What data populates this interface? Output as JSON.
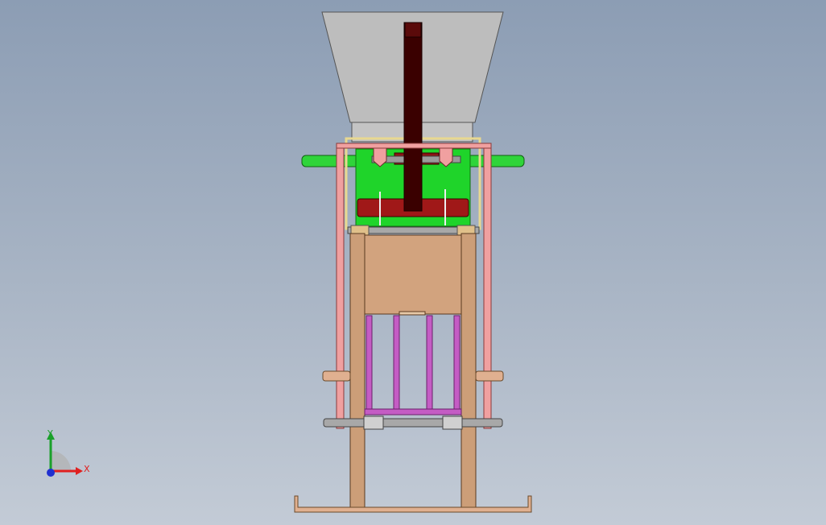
{
  "viewport": {
    "background_top": "#8c9db4",
    "background_bottom": "#c3cbd6"
  },
  "triad": {
    "x_label": "X",
    "y_label": "Y",
    "x_color": "#e02020",
    "y_color": "#1aa02a",
    "z_color": "#2030d0"
  },
  "model": {
    "hopper_color": "#b9b9b9",
    "frame_color": "#cc9e78",
    "side_rail_color": "#f0a0a0",
    "feeder_box_color": "#1fd42a",
    "shaft_color": "#2fd43a",
    "roller_color": "#8c1414",
    "lever_color": "#3a0000",
    "mold_bar_color": "#c45cc4",
    "axle_color": "#a8a8a8",
    "pin_color": "#e0b090"
  }
}
